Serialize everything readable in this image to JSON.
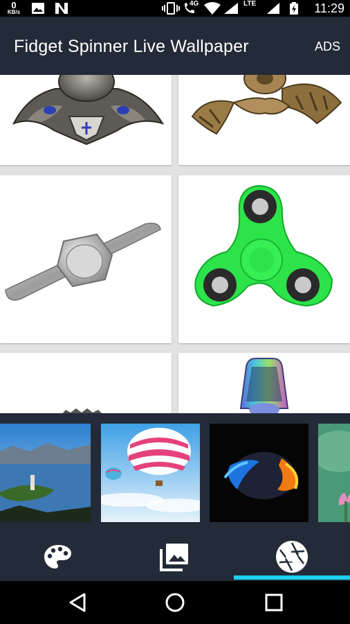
{
  "status_bar": {
    "speed_value": "0",
    "speed_unit": "KB/s",
    "network_type": "4G",
    "lte_label": "LTE",
    "time": "11:29",
    "icons": [
      "gallery-icon",
      "n-logo-icon",
      "vibrate-icon",
      "wifi-calling-icon",
      "wifi-icon",
      "signal-icon",
      "battery-charging-icon"
    ]
  },
  "app_bar": {
    "title": "Fidget Spinner Live Wallpaper",
    "ads_label": "ADS"
  },
  "colors": {
    "app_bar_bg": "#232b38",
    "grid_bg": "#e2e2e2",
    "tab_indicator": "#19d3f0",
    "spinner_green": "#2de34a"
  },
  "grid": {
    "items": [
      {
        "name": "dragon-metal-spinner"
      },
      {
        "name": "bronze-dragon-spinner"
      },
      {
        "name": "silver-bar-spinner"
      },
      {
        "name": "green-tri-spinner"
      },
      {
        "name": "gear-spinner"
      },
      {
        "name": "rainbow-chrome-spinner"
      }
    ]
  },
  "backgrounds": {
    "items": [
      {
        "name": "lake-island-background"
      },
      {
        "name": "hot-air-balloon-background"
      },
      {
        "name": "fire-ice-planet-background"
      },
      {
        "name": "lotus-flower-background"
      }
    ]
  },
  "tabs": [
    {
      "name": "palette-icon",
      "selected": false
    },
    {
      "name": "gallery-icon",
      "selected": false
    },
    {
      "name": "shutter-icon",
      "selected": true
    }
  ],
  "nav": [
    "back-icon",
    "home-icon",
    "recents-icon"
  ]
}
